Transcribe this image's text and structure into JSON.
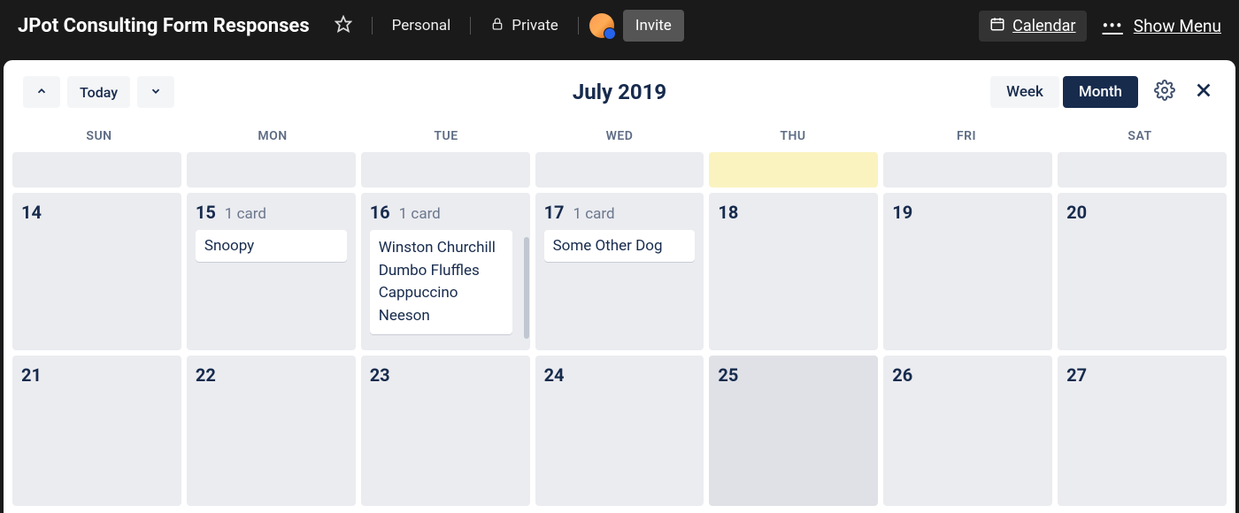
{
  "header": {
    "board_title": "JPot Consulting Form Responses",
    "personal_label": "Personal",
    "private_label": "Private",
    "invite_label": "Invite",
    "calendar_label": "Calendar",
    "show_menu_label": "Show Menu"
  },
  "toolbar": {
    "today_label": "Today",
    "month_title": "July 2019",
    "week_label": "Week",
    "month_label": "Month"
  },
  "day_headers": [
    "SUN",
    "MON",
    "TUE",
    "WED",
    "THU",
    "FRI",
    "SAT"
  ],
  "weeks": [
    {
      "days": [
        {
          "date": "14",
          "card_count": null,
          "cards": []
        },
        {
          "date": "15",
          "card_count": "1 card",
          "cards": [
            "Snoopy"
          ]
        },
        {
          "date": "16",
          "card_count": "1 card",
          "cards": [
            "Winston Churchill Dumbo Fluffles Cappuccino Neeson"
          ],
          "multiline": true
        },
        {
          "date": "17",
          "card_count": "1 card",
          "cards": [
            "Some Other Dog"
          ]
        },
        {
          "date": "18",
          "card_count": null,
          "cards": []
        },
        {
          "date": "19",
          "card_count": null,
          "cards": []
        },
        {
          "date": "20",
          "card_count": null,
          "cards": []
        }
      ]
    },
    {
      "days": [
        {
          "date": "21"
        },
        {
          "date": "22"
        },
        {
          "date": "23"
        },
        {
          "date": "24"
        },
        {
          "date": "25"
        },
        {
          "date": "26"
        },
        {
          "date": "27"
        }
      ]
    }
  ]
}
